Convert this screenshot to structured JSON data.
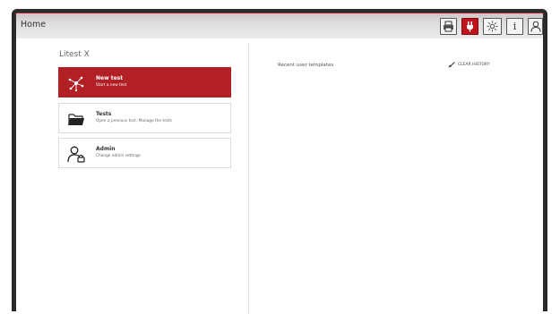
{
  "header": {
    "title": "Home",
    "buttons": [
      {
        "name": "print-icon"
      },
      {
        "name": "plug-icon"
      },
      {
        "name": "brightness-icon"
      },
      {
        "name": "info-icon",
        "label": "i"
      },
      {
        "name": "user-icon"
      }
    ]
  },
  "app": {
    "title": "Litest X"
  },
  "menu": {
    "items": [
      {
        "title": "New test",
        "subtitle": "Start a new test",
        "icon": "network-icon",
        "active": true
      },
      {
        "title": "Tests",
        "subtitle": "Open a previous test, Manage the tests",
        "icon": "folder-open-icon",
        "active": false
      },
      {
        "title": "Admin",
        "subtitle": "Change admin settings",
        "icon": "admin-user-icon",
        "active": false
      }
    ]
  },
  "recent": {
    "title": "Recent user templates",
    "clear_label": "CLEAR HISTORY",
    "clear_icon": "broom-icon"
  },
  "colors": {
    "accent": "#b21f25",
    "header_bg": "#e4e2e2"
  }
}
